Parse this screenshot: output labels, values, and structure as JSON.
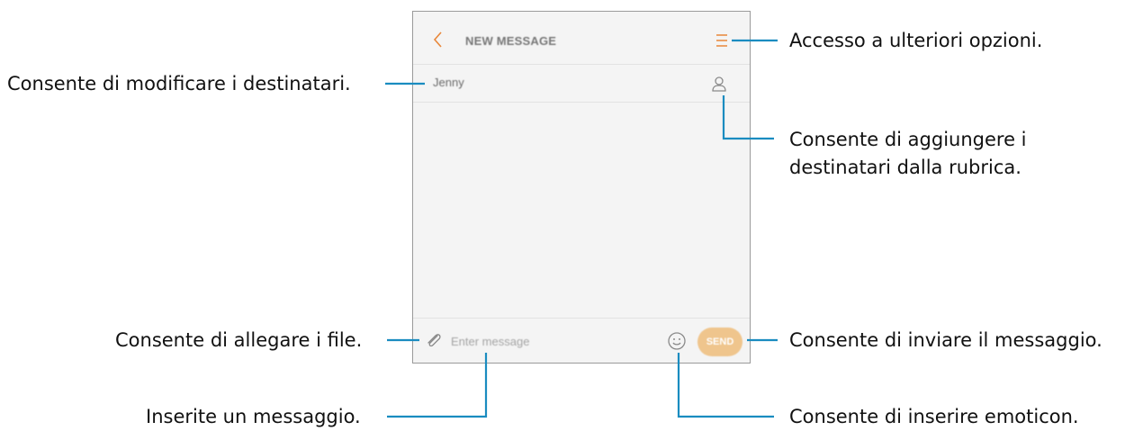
{
  "screen": {
    "title": "NEW MESSAGE",
    "recipient": "Jenny",
    "message_placeholder": "Enter message",
    "send_label": "SEND"
  },
  "callouts": {
    "options": "Accesso a ulteriori opzioni.",
    "edit_recipients": "Consente di modificare i destinatari.",
    "add_contacts_line1": "Consente di aggiungere i",
    "add_contacts_line2": "destinatari dalla rubrica.",
    "attach_files": "Consente di allegare i file.",
    "send_message": "Consente di inviare il messaggio.",
    "enter_message": "Inserite un messaggio.",
    "insert_emoticon": "Consente di inserire emoticon."
  },
  "colors": {
    "accent": "#E8873A",
    "send_button": "#EFC58D",
    "leader_line": "#1A8CC0",
    "screen_background": "#F4F4F4"
  },
  "icons": [
    "back-arrow-icon",
    "menu-icon",
    "contact-icon",
    "paperclip-icon",
    "smiley-icon"
  ]
}
